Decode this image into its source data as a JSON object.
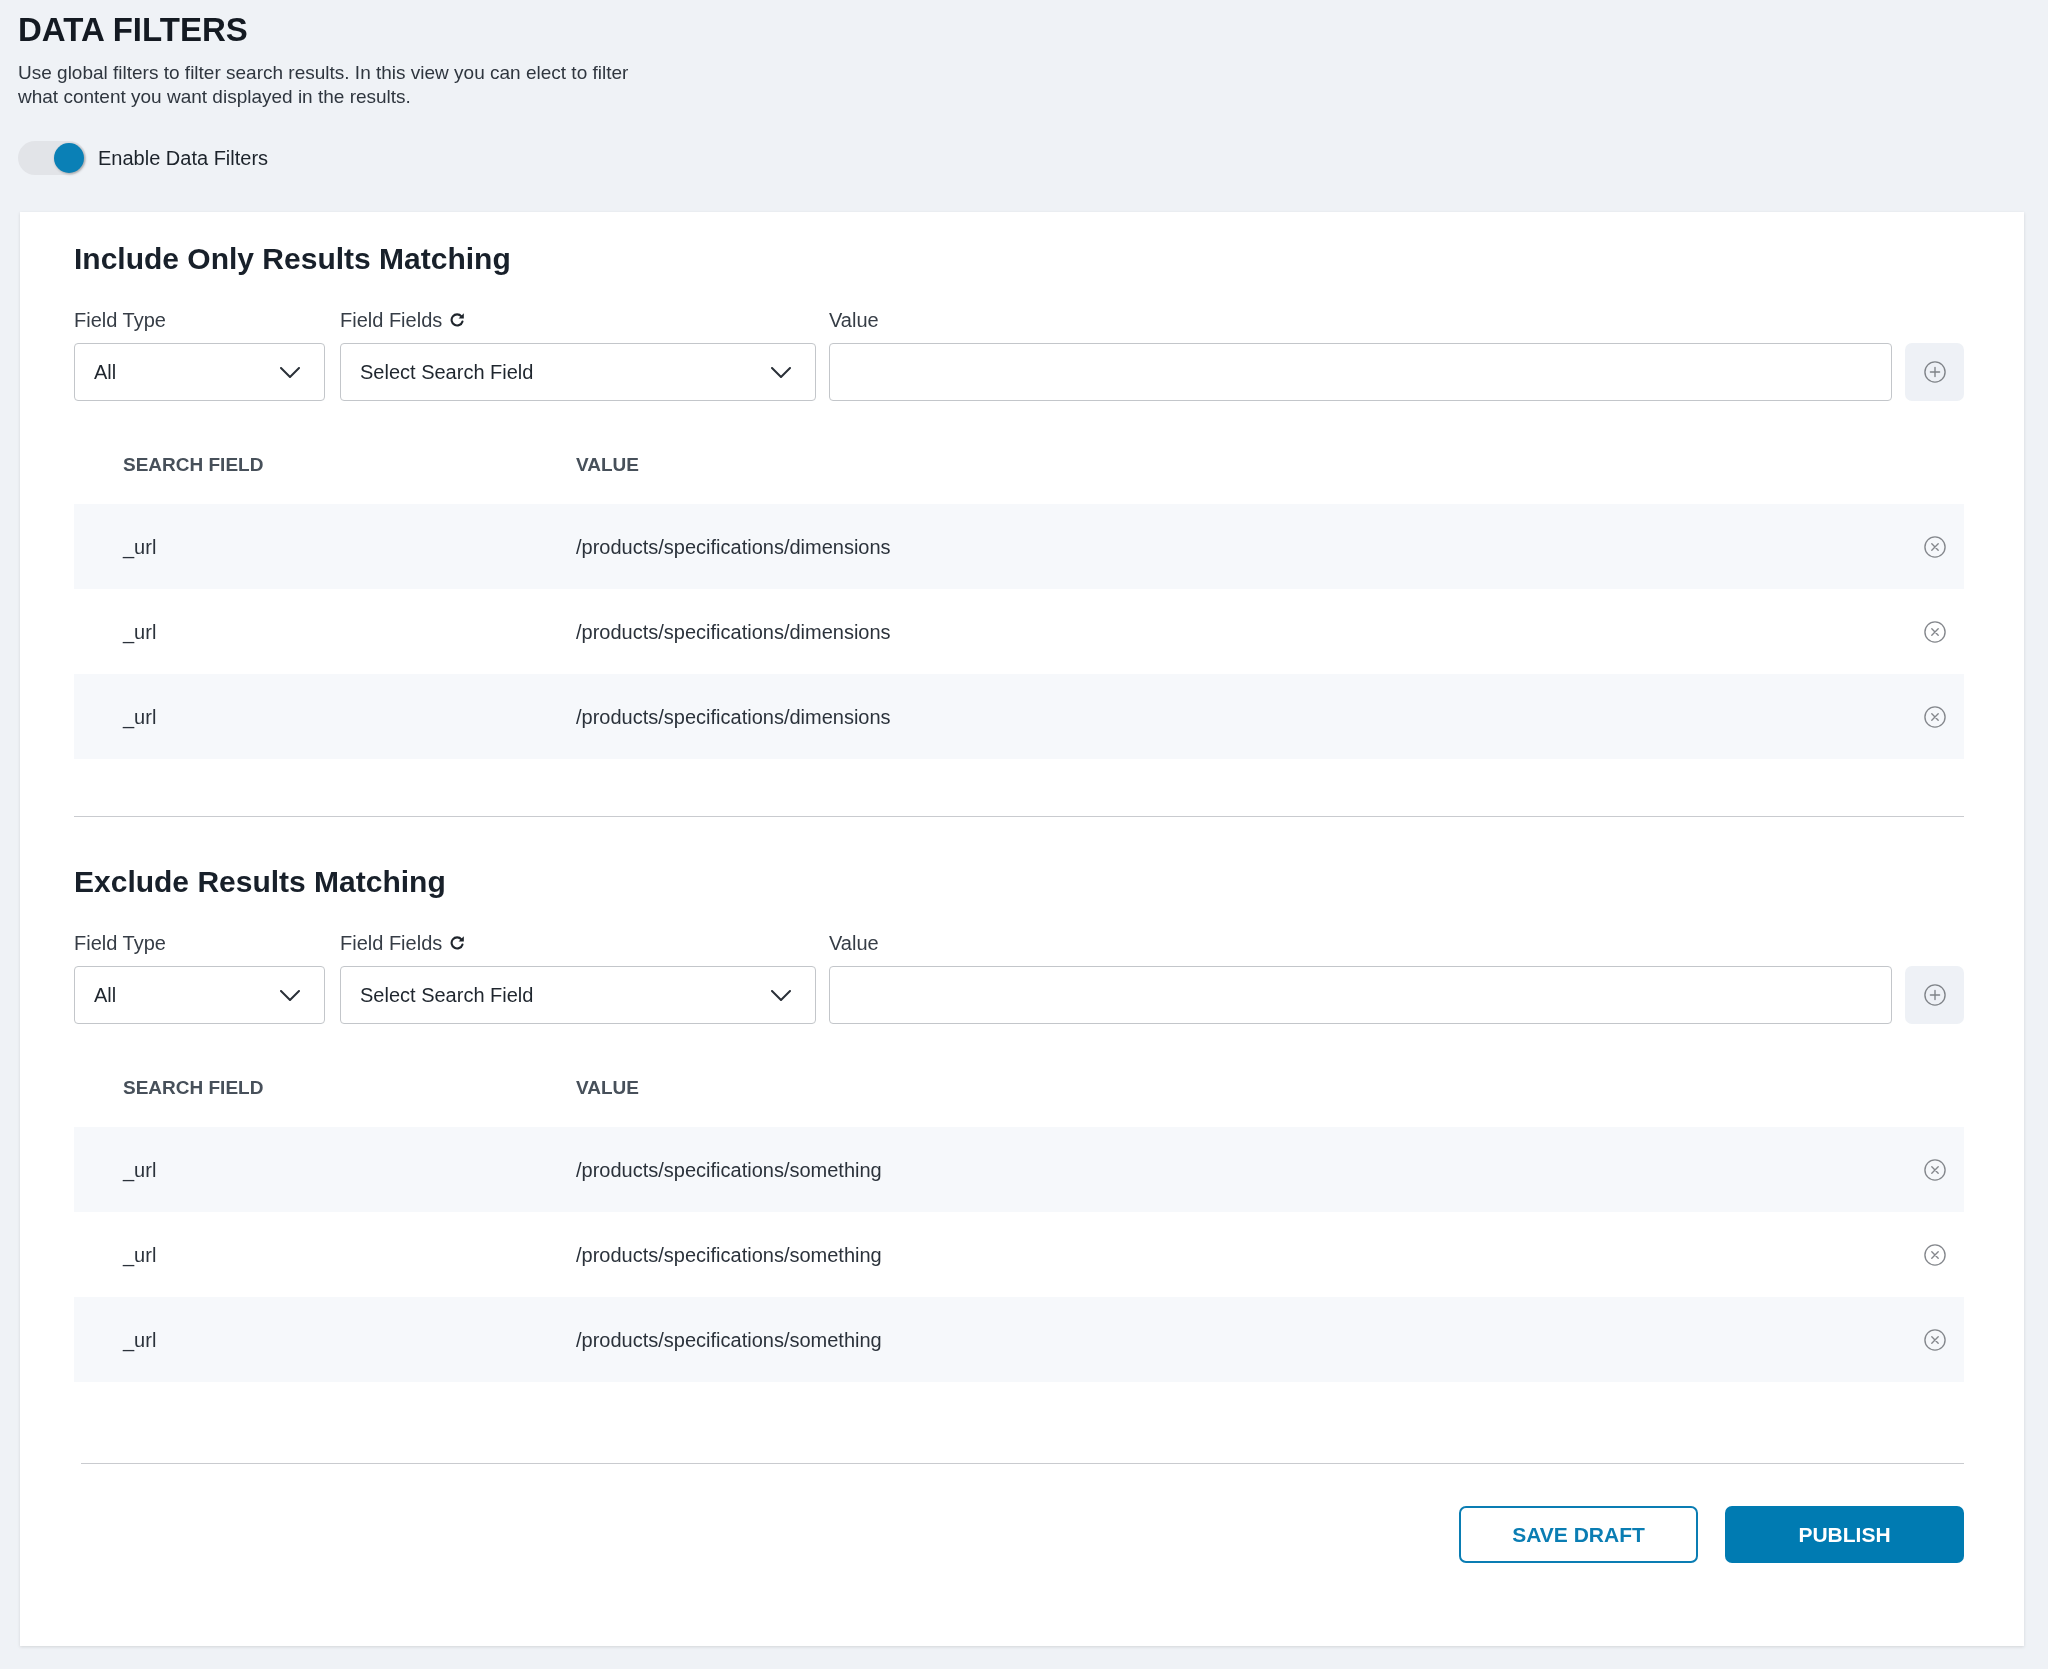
{
  "header": {
    "title": "DATA FILTERS",
    "description": "Use global filters to filter search results. In this view you can elect to filter what content you want displayed in the results.",
    "toggle": {
      "label": "Enable Data Filters",
      "on": true
    }
  },
  "sections": [
    {
      "title": "Include Only Results Matching",
      "fields": [
        {
          "kind": "select",
          "label": "Field Type",
          "value": "All",
          "refreshable": false
        },
        {
          "kind": "select",
          "label": "Field Fields",
          "value": "Select Search Field",
          "refreshable": true
        },
        {
          "kind": "text",
          "label": "Value",
          "refreshable": false
        }
      ],
      "columns": [
        "SEARCH FIELD",
        "VALUE"
      ],
      "rows": [
        {
          "field": "_url",
          "value": "/products/specifications/dimensions"
        },
        {
          "field": "_url",
          "value": "/products/specifications/dimensions"
        },
        {
          "field": "_url",
          "value": "/products/specifications/dimensions"
        }
      ]
    },
    {
      "title": "Exclude Results Matching",
      "fields": [
        {
          "kind": "select",
          "label": "Field Type",
          "value": "All",
          "refreshable": false
        },
        {
          "kind": "select",
          "label": "Field Fields",
          "value": "Select Search Field",
          "refreshable": true
        },
        {
          "kind": "text",
          "label": "Value",
          "refreshable": false
        }
      ],
      "columns": [
        "SEARCH FIELD",
        "VALUE"
      ],
      "rows": [
        {
          "field": "_url",
          "value": "/products/specifications/something"
        },
        {
          "field": "_url",
          "value": "/products/specifications/something"
        },
        {
          "field": "_url",
          "value": "/products/specifications/something"
        }
      ]
    }
  ],
  "buttons": [
    {
      "kind": "outline",
      "label": "SAVE DRAFT"
    },
    {
      "kind": "primary",
      "label": "PUBLISH"
    }
  ]
}
